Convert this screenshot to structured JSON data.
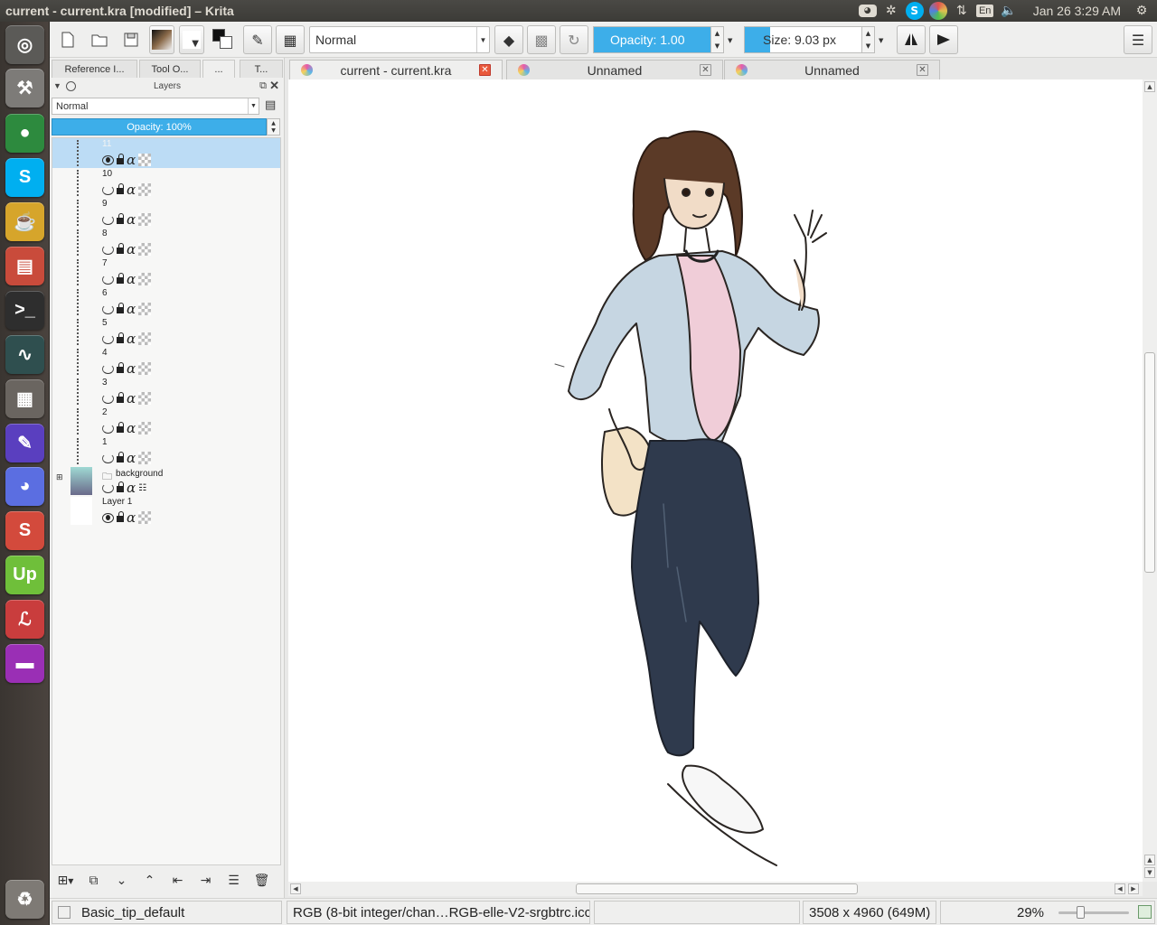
{
  "window": {
    "title": "current - current.kra [modified] – Krita"
  },
  "tray": {
    "icons": [
      "discord-icon",
      "settings-icon",
      "skype-icon",
      "color-icon",
      "network-icon"
    ],
    "keyboard_layout": "En",
    "volume_icon": "volume-icon",
    "clock": "Jan 26  3:29 AM",
    "gear_icon": "system-gear-icon"
  },
  "launcher": {
    "items": [
      {
        "name": "ubuntu-dash-icon",
        "glyph": "◎",
        "color": "#5b5a57"
      },
      {
        "name": "system-settings-icon",
        "glyph": "⚒",
        "color": "#7d7b78"
      },
      {
        "name": "chrome-icon",
        "glyph": "●",
        "color": "#2d8a3e"
      },
      {
        "name": "skype-icon",
        "glyph": "S",
        "color": "#00aff0"
      },
      {
        "name": "teapot-icon",
        "glyph": "☕",
        "color": "#d6a52b"
      },
      {
        "name": "files-icon",
        "glyph": "▤",
        "color": "#c94b3b"
      },
      {
        "name": "terminal-icon",
        "glyph": ">_",
        "color": "#2e2e2e"
      },
      {
        "name": "system-monitor-icon",
        "glyph": "∿",
        "color": "#2f4f4f"
      },
      {
        "name": "workspace-switcher-icon",
        "glyph": "▦",
        "color": "#6a6560"
      },
      {
        "name": "krita-icon",
        "glyph": "✎",
        "color": "#5a3fbf"
      },
      {
        "name": "discord-icon",
        "glyph": "◕",
        "color": "#5b6ee1"
      },
      {
        "name": "slack-icon",
        "glyph": "S",
        "color": "#d34a3c"
      },
      {
        "name": "upwork-icon",
        "glyph": "Up",
        "color": "#6fbf3a"
      },
      {
        "name": "document-viewer-icon",
        "glyph": "ℒ",
        "color": "#c93d3d"
      },
      {
        "name": "video-app-icon",
        "glyph": "▬",
        "color": "#9a2fb5"
      },
      {
        "name": "trash-icon",
        "glyph": "♻",
        "color": "#7e7a75"
      }
    ]
  },
  "toolbar": {
    "new_icon": "new-document-icon",
    "open_icon": "open-folder-icon",
    "save_icon": "save-icon",
    "blend_mode": "Normal",
    "opacity_label": "Opacity:  1.00",
    "opacity_value": 1.0,
    "size_label": "Size:  9.03 px",
    "size_fraction": 0.22,
    "mirror_h_icon": "mirror-horizontal-icon",
    "mirror_v_icon": "mirror-vertical-icon"
  },
  "docker": {
    "tabs": [
      "Reference I...",
      "Tool O...",
      "...",
      "T..."
    ],
    "layers_title": "Layers",
    "blend_mode": "Normal",
    "opacity": "Opacity:  100%",
    "layers": [
      {
        "label": "11",
        "visible": true,
        "selected": true
      },
      {
        "label": "10",
        "visible": false,
        "selected": false
      },
      {
        "label": "9",
        "visible": false,
        "selected": false
      },
      {
        "label": "8",
        "visible": false,
        "selected": false
      },
      {
        "label": "7",
        "visible": false,
        "selected": false
      },
      {
        "label": "6",
        "visible": false,
        "selected": false
      },
      {
        "label": "5",
        "visible": false,
        "selected": false
      },
      {
        "label": "4",
        "visible": false,
        "selected": false
      },
      {
        "label": "3",
        "visible": false,
        "selected": false
      },
      {
        "label": "2",
        "visible": false,
        "selected": false
      },
      {
        "label": "1",
        "visible": false,
        "selected": false
      }
    ],
    "group_layer": "background",
    "base_layer": "Layer 1"
  },
  "doc_tabs": [
    {
      "label": "current - current.kra",
      "active": true
    },
    {
      "label": "Unnamed",
      "active": false
    },
    {
      "label": "Unnamed",
      "active": false
    }
  ],
  "status": {
    "brush": "Basic_tip_default",
    "color_profile": "RGB (8-bit integer/chan…RGB-elle-V2-srgbtrc.icc",
    "image_size": "3508 x 4960 (649M)",
    "zoom": "29%"
  }
}
